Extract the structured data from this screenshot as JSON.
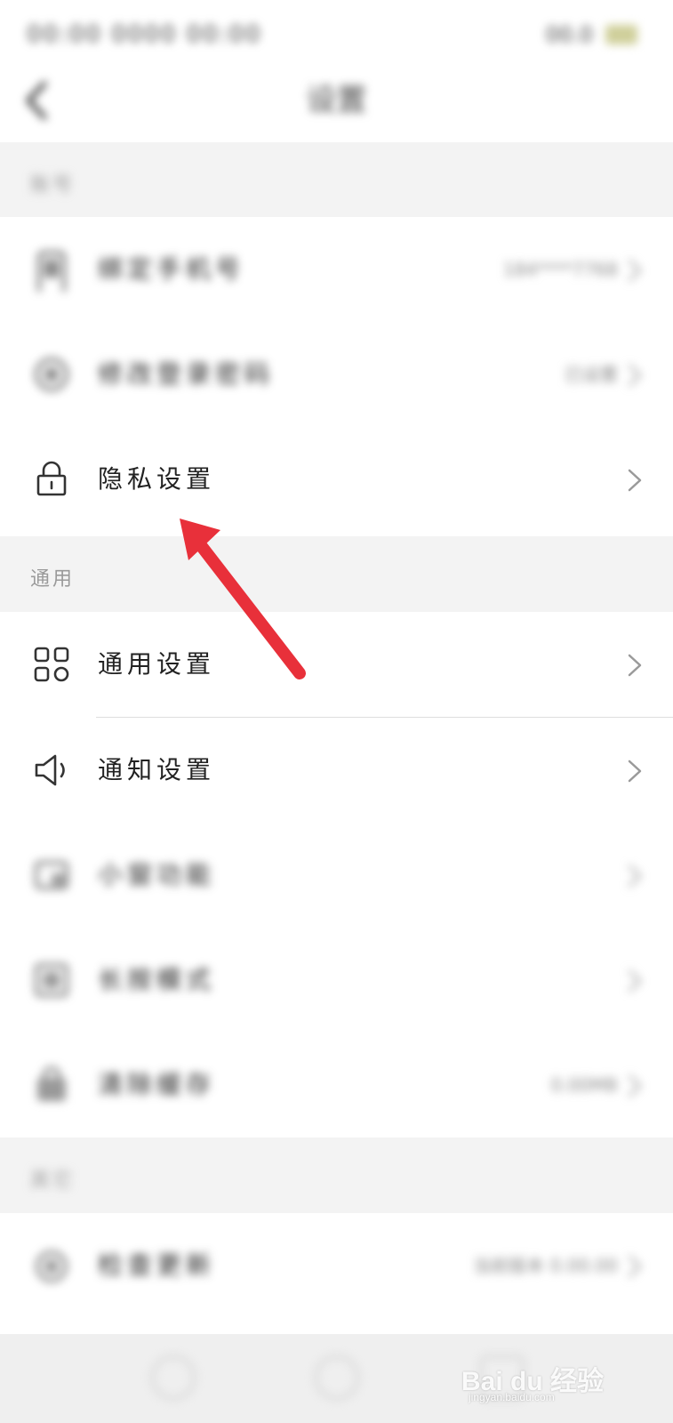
{
  "status_bar": {
    "time_text": "00:00 0000 00:00",
    "right_text": "00.0"
  },
  "header": {
    "title": "设置",
    "back_icon": "chevron-left-icon"
  },
  "sections": {
    "account": {
      "label": "账号",
      "rows": [
        {
          "label": "绑定手机号",
          "value": "184****7768",
          "icon": "phone-icon"
        },
        {
          "label": "修改登录密码",
          "value": "已设置",
          "icon": "shield-icon"
        },
        {
          "label": "隐私设置",
          "value": "",
          "icon": "lock-icon"
        }
      ]
    },
    "general": {
      "label": "通用",
      "rows": [
        {
          "label": "通用设置",
          "value": "",
          "icon": "grid-icon"
        },
        {
          "label": "通知设置",
          "value": "",
          "icon": "speaker-icon"
        },
        {
          "label": "小窗功能",
          "value": "",
          "icon": "window-icon"
        },
        {
          "label": "长按模式",
          "value": "",
          "icon": "square-icon"
        },
        {
          "label": "清除缓存",
          "value": "0.00MB",
          "icon": "bag-icon"
        }
      ]
    },
    "other": {
      "label": "其它",
      "rows": [
        {
          "label": "检查更新",
          "value": "当前版本 0.00.00",
          "icon": "update-icon"
        }
      ]
    }
  },
  "watermark": {
    "brand": "Bai du 经验",
    "url": "jingyan.baidu.com"
  },
  "colors": {
    "arrow": "#e8303a",
    "section_bg": "#f3f3f3",
    "chevron": "#9a9a9a"
  }
}
